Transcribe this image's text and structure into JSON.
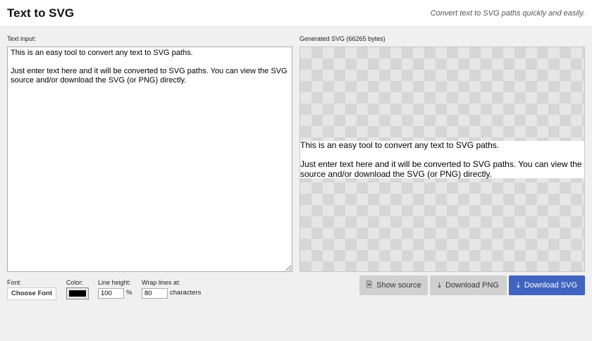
{
  "header": {
    "title": "Text to SVG",
    "tagline": "Convert text to SVG paths quickly and easily."
  },
  "input": {
    "label": "Text input:",
    "value": "This is an easy tool to convert any text to SVG paths.\n\nJust enter text here and it will be converted to SVG paths. You can view the SVG source and/or download the SVG (or PNG) directly."
  },
  "output": {
    "label": "Generated SVG (66265 bytes)",
    "rendered_text": "This is an easy tool to convert any text to SVG paths.\n\nJust enter text here and it will be converted to SVG paths. You can view the SVG\nsource and/or download the SVG (or PNG) directly."
  },
  "options": {
    "font_label": "Font:",
    "font_button": "Choose Font",
    "color_label": "Color:",
    "color_value": "#000000",
    "line_height_label": "Line height:",
    "line_height_value": "100",
    "line_height_unit": "%",
    "wrap_label": "Wrap lines at:",
    "wrap_value": "80",
    "wrap_unit": "characters"
  },
  "actions": {
    "show_source": "Show source",
    "download_png": "Download PNG",
    "download_svg": "Download SVG"
  },
  "colors": {
    "primary": "#4064c0"
  }
}
